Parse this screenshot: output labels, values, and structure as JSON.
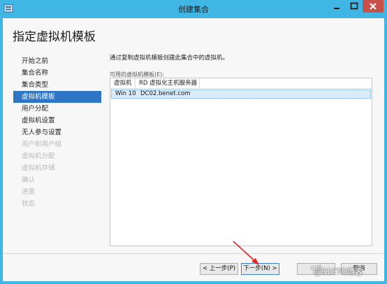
{
  "window": {
    "title": "创建集合",
    "accent": "#3fb6e3",
    "close_color": "#c7504a"
  },
  "page": {
    "title": "指定虚拟机模板"
  },
  "nav": {
    "items": [
      {
        "label": "开始之前",
        "state": "normal"
      },
      {
        "label": "集合名称",
        "state": "normal"
      },
      {
        "label": "集合类型",
        "state": "normal"
      },
      {
        "label": "虚拟机模板",
        "state": "active"
      },
      {
        "label": "用户分配",
        "state": "normal"
      },
      {
        "label": "虚拟机设置",
        "state": "normal"
      },
      {
        "label": "无人参与设置",
        "state": "normal"
      },
      {
        "label": "用户和用户组",
        "state": "disabled"
      },
      {
        "label": "虚拟机分配",
        "state": "disabled"
      },
      {
        "label": "虚拟机存储",
        "state": "disabled"
      },
      {
        "label": "确认",
        "state": "disabled"
      },
      {
        "label": "进度",
        "state": "disabled"
      },
      {
        "label": "状态",
        "state": "disabled"
      }
    ]
  },
  "main": {
    "description": "通过复制虚拟机模板创建此集合中的虚拟机。",
    "list_label": "可用的虚拟机模板(E):",
    "columns": [
      "虚拟机",
      "RD 虚拟化主机服务器"
    ],
    "rows": [
      [
        "Win 10",
        "DC02.benet.com"
      ]
    ]
  },
  "footer": {
    "prev": "< 上一步(P)",
    "next": "下一步(N) >",
    "create": "创建",
    "cancel": "取消"
  },
  "watermark": "@51CTO博客"
}
